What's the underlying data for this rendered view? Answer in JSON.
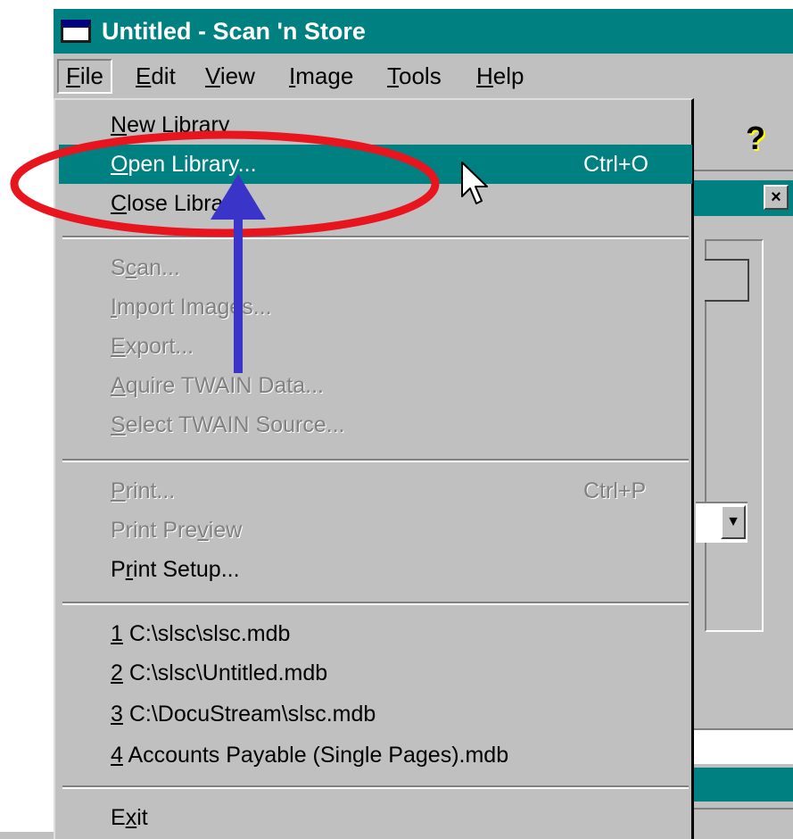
{
  "window": {
    "title": "Untitled - Scan 'n Store"
  },
  "menubar": {
    "items": [
      {
        "label": "File",
        "accel": "F",
        "rest": "ile"
      },
      {
        "label": "Edit",
        "accel": "E",
        "rest": "dit"
      },
      {
        "label": "View",
        "accel": "V",
        "rest": "iew"
      },
      {
        "label": "Image",
        "accel": "I",
        "rest": "mage"
      },
      {
        "label": "Tools",
        "accel": "T",
        "rest": "ools"
      },
      {
        "label": "Help",
        "accel": "H",
        "rest": "elp"
      }
    ]
  },
  "file_menu": {
    "items": [
      {
        "pre": "",
        "accel": "N",
        "post": "ew Library",
        "shortcut": ""
      },
      {
        "pre": "",
        "accel": "O",
        "post": "pen Library...",
        "shortcut": "Ctrl+O"
      },
      {
        "pre": "",
        "accel": "C",
        "post": "lose Library",
        "shortcut": ""
      },
      {
        "pre": "S",
        "accel": "c",
        "post": "an...",
        "shortcut": ""
      },
      {
        "pre": "",
        "accel": "I",
        "post": "mport Images...",
        "shortcut": ""
      },
      {
        "pre": "",
        "accel": "E",
        "post": "xport...",
        "shortcut": ""
      },
      {
        "pre": "",
        "accel": "A",
        "post": "quire TWAIN Data...",
        "shortcut": ""
      },
      {
        "pre": "",
        "accel": "S",
        "post": "elect TWAIN Source...",
        "shortcut": ""
      },
      {
        "pre": "",
        "accel": "P",
        "post": "rint...",
        "shortcut": "Ctrl+P"
      },
      {
        "pre": "Print Pre",
        "accel": "v",
        "post": "iew",
        "shortcut": ""
      },
      {
        "pre": "P",
        "accel": "r",
        "post": "int Setup...",
        "shortcut": ""
      },
      {
        "pre": "",
        "accel": "1",
        "post": " C:\\slsc\\slsc.mdb",
        "shortcut": ""
      },
      {
        "pre": "",
        "accel": "2",
        "post": " C:\\slsc\\Untitled.mdb",
        "shortcut": ""
      },
      {
        "pre": "",
        "accel": "3",
        "post": " C:\\DocuStream\\slsc.mdb",
        "shortcut": ""
      },
      {
        "pre": "",
        "accel": "4",
        "post": " Accounts Payable (Single Pages).mdb",
        "shortcut": ""
      },
      {
        "pre": "E",
        "accel": "x",
        "post": "it",
        "shortcut": ""
      }
    ]
  },
  "toolbar": {
    "help_icon": "?"
  },
  "colors": {
    "title_bar": "#008080",
    "highlight": "#008080",
    "annotation_ellipse": "#e8141e",
    "annotation_arrow": "#3a34c8"
  }
}
